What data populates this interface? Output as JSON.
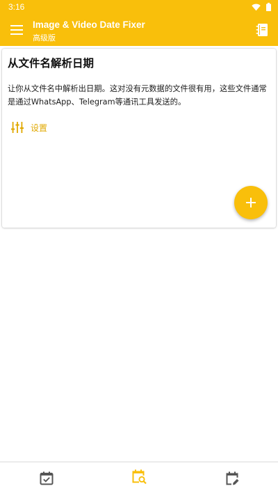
{
  "status_bar": {
    "time": "3:16"
  },
  "app_bar": {
    "title": "Image & Video Date Fixer",
    "subtitle": "高级版"
  },
  "card": {
    "title": "从文件名解析日期",
    "description": "让你从文件名中解析出日期。这对没有元数据的文件很有用，这些文件通常是通过WhatsApp、Telegram等通讯工具发送的。",
    "settings_label": "设置"
  },
  "fab": {
    "label": "+"
  },
  "bottom_nav": {
    "items": [
      {
        "icon": "calendar-check-icon",
        "active": false
      },
      {
        "icon": "calendar-search-icon",
        "active": true
      },
      {
        "icon": "calendar-edit-icon",
        "active": false
      }
    ]
  },
  "colors": {
    "primary": "#f9bf0b",
    "accent_text": "#e0a800",
    "nav_inactive": "#555555"
  }
}
